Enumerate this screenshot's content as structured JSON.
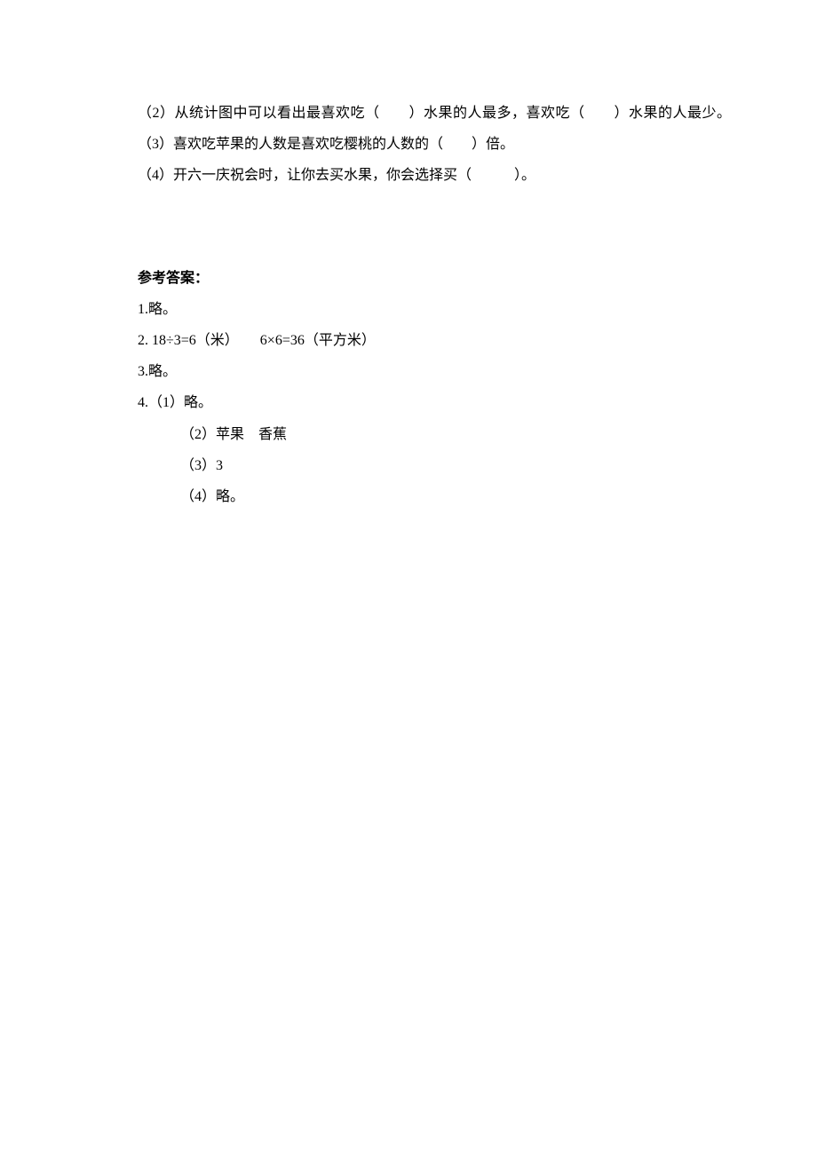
{
  "questions": {
    "q2": "（2）从统计图中可以看出最喜欢吃（　　）水果的人最多，喜欢吃（　　）水果的人最少。",
    "q3": "（3）喜欢吃苹果的人数是喜欢吃樱桃的人数的（　　）倍。",
    "q4": "（4）开六一庆祝会时，让你去买水果，你会选择买（　　　）。"
  },
  "answers": {
    "heading": "参考答案：",
    "a1": "1.略。",
    "a2": "2. 18÷3=6（米）　　6×6=36（平方米）",
    "a3": "3.略。",
    "a4_main": "4.（1）略。",
    "a4_2": "（2）苹果　香蕉",
    "a4_3": "（3）3",
    "a4_4": "（4）略。"
  }
}
